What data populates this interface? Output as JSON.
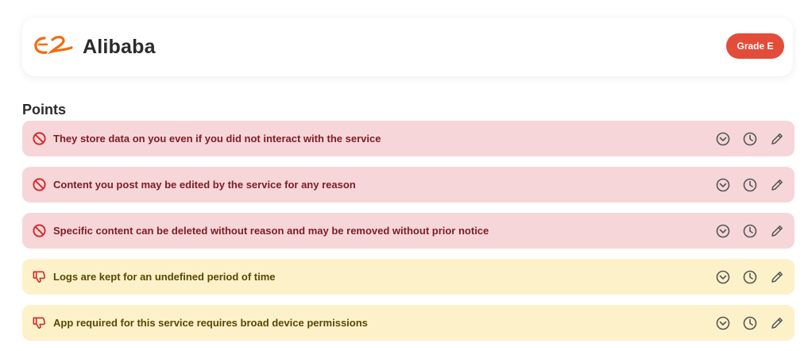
{
  "service": {
    "name": "Alibaba",
    "grade": "Grade E",
    "logo_icon": "alibaba-logo-icon"
  },
  "section": {
    "title": "Points"
  },
  "colors": {
    "grade_badge": "#e44c3a",
    "blocker_bg": "#f6d6d9",
    "blocker_text": "#7c1d24",
    "bad_bg": "#fdf1c9",
    "bad_text": "#5a4705",
    "logo_orange": "#f26b0e"
  },
  "points": [
    {
      "text": "They store data on you even if you did not interact with the service",
      "severity": "blocker",
      "icon": "no-entry-icon"
    },
    {
      "text": "Content you post may be edited by the service for any reason",
      "severity": "blocker",
      "icon": "no-entry-icon"
    },
    {
      "text": "Specific content can be deleted without reason and may be removed without prior notice",
      "severity": "blocker",
      "icon": "no-entry-icon"
    },
    {
      "text": "Logs are kept for an undefined period of time",
      "severity": "bad",
      "icon": "thumbs-down-icon"
    },
    {
      "text": "App required for this service requires broad device permissions",
      "severity": "bad",
      "icon": "thumbs-down-icon"
    }
  ],
  "point_actions": [
    "expand-circle-icon",
    "history-clock-icon",
    "edit-pencil-icon"
  ]
}
